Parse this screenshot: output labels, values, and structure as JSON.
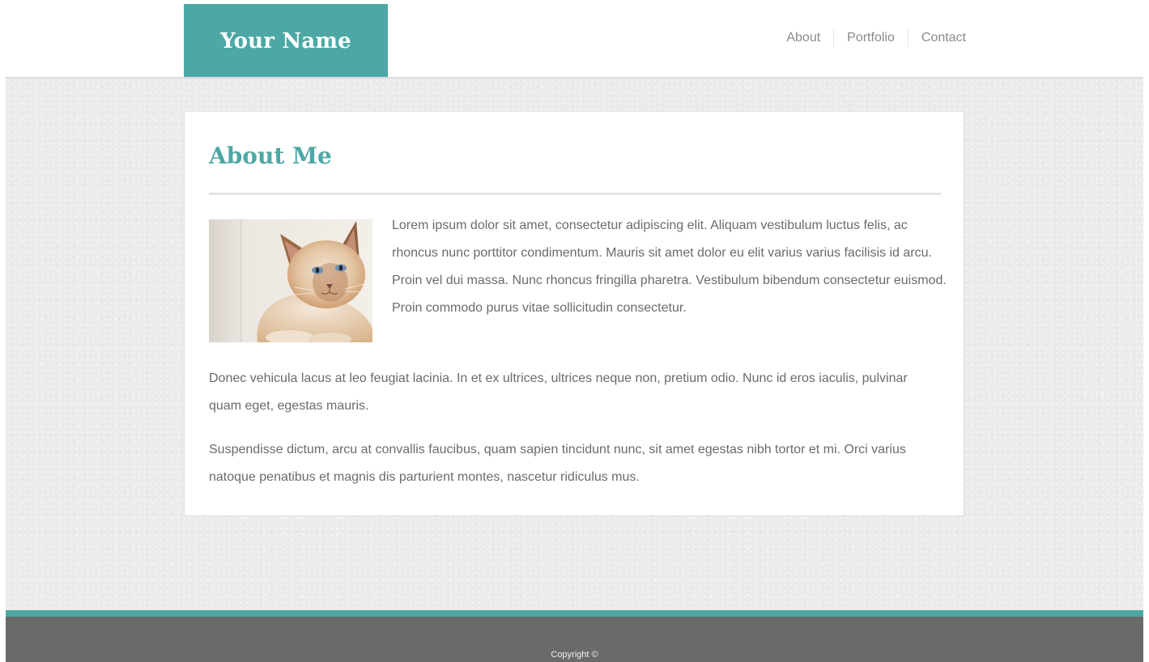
{
  "header": {
    "logo_text": "Your Name",
    "brand_color": "#4ba8a5",
    "nav": [
      {
        "label": "About"
      },
      {
        "label": "Portfolio"
      },
      {
        "label": "Contact"
      }
    ]
  },
  "main": {
    "title": "About Me",
    "photo_icon": "cat-photo",
    "paragraphs": [
      "Lorem ipsum dolor sit amet, consectetur adipiscing elit. Aliquam vestibulum luctus felis, ac rhoncus nunc porttitor condimentum. Mauris sit amet dolor eu elit varius varius facilisis id arcu. Proin vel dui massa. Nunc rhoncus fringilla pharetra. Vestibulum bibendum consectetur euismod. Proin commodo purus vitae sollicitudin consectetur.",
      "Donec vehicula lacus at leo feugiat lacinia. In et ex ultrices, ultrices neque non, pretium odio. Nunc id eros iaculis, pulvinar quam eget, egestas mauris.",
      "Suspendisse dictum, arcu at convallis faucibus, quam sapien tincidunt nunc, sit amet egestas nibh tortor et mi. Orci varius natoque penatibus et magnis dis parturient montes, nascetur ridiculus mus."
    ]
  },
  "footer": {
    "copyright": "Copyright ©",
    "background_color": "#6a6a6a"
  }
}
